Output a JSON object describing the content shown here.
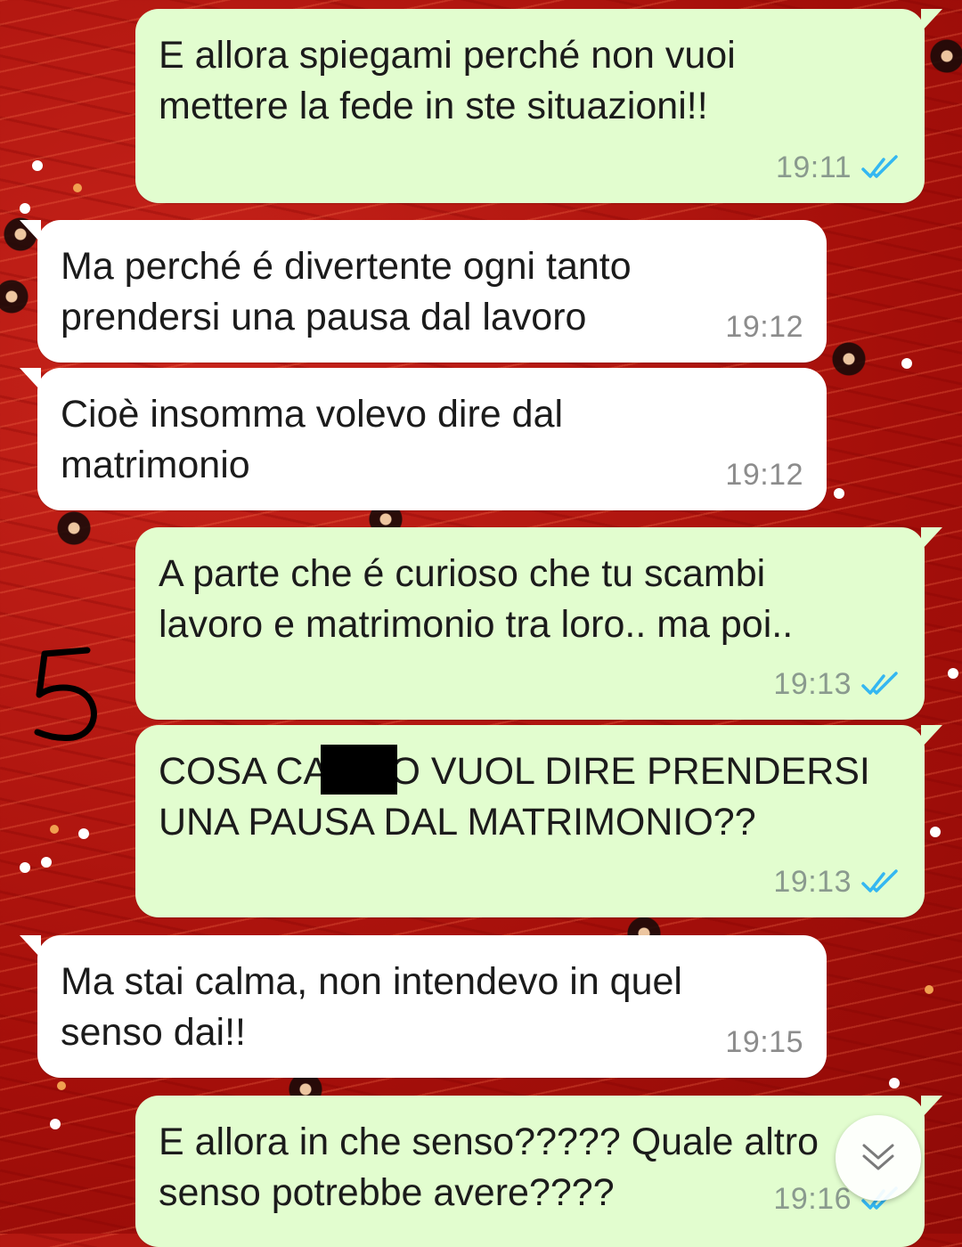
{
  "chat": {
    "messages": [
      {
        "direction": "out",
        "text": "E allora spiegami perché non vuoi\nmettere la fede in ste situazioni!!",
        "time": "19:11",
        "status": "read"
      },
      {
        "direction": "in",
        "text": "Ma perché é divertente ogni tanto\nprendersi una pausa dal lavoro",
        "time": "19:12"
      },
      {
        "direction": "in",
        "text": "Cioè insomma volevo dire dal\nmatrimonio",
        "time": "19:12"
      },
      {
        "direction": "out",
        "text": "A parte che é curioso che tu scambi\nlavoro e matrimonio tra loro.. ma poi..",
        "time": "19:13",
        "status": "read"
      },
      {
        "direction": "out",
        "text": "COSA CA      O VUOL DIRE PRENDERSI\nUNA PAUSA DAL MATRIMONIO??",
        "time": "19:13",
        "status": "read"
      },
      {
        "direction": "in",
        "text": "Ma stai calma, non intendevo in quel\nsenso dai!!",
        "time": "19:15"
      },
      {
        "direction": "out",
        "text": "E allora in che senso????? Quale altro\nsenso potrebbe avere????",
        "time": "19:16",
        "status": "read"
      }
    ]
  },
  "annotation": {
    "label": "5"
  },
  "icons": {
    "read_ticks": "double-check-icon",
    "scroll_down": "chevron-down-icon"
  },
  "colors": {
    "outgoing_bubble": "#e2fdcf",
    "incoming_bubble": "#ffffff",
    "read_ticks": "#34b7f1",
    "wallpaper": "#b3140e"
  }
}
